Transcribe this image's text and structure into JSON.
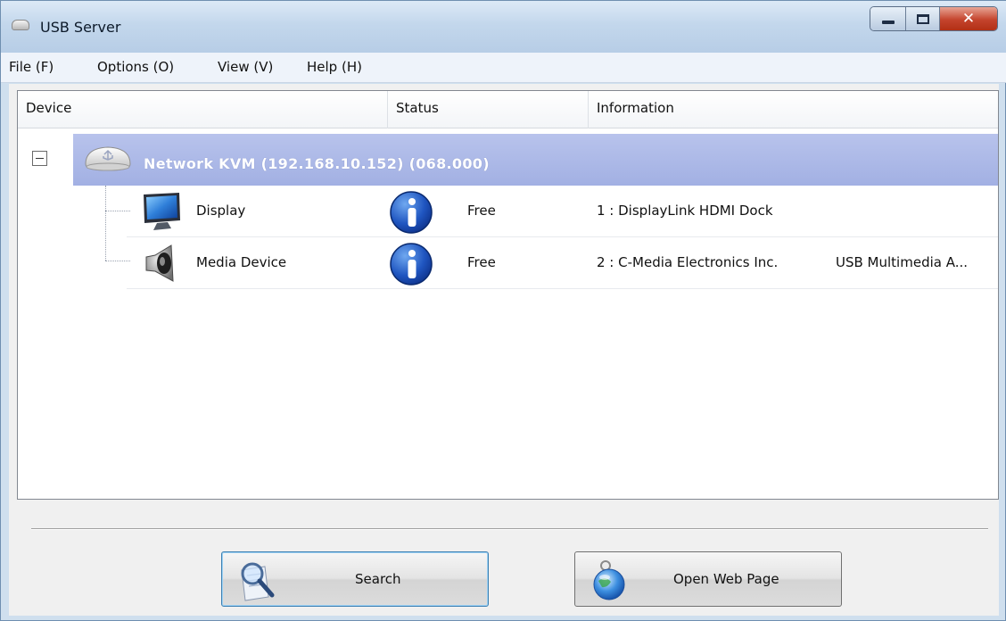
{
  "window": {
    "title": "USB Server"
  },
  "menu": {
    "items": [
      "File (F)",
      "Options (O)",
      "View (V)",
      "Help (H)"
    ]
  },
  "list": {
    "columns": [
      "Device",
      "Status",
      "Information"
    ],
    "group": {
      "label": "Network KVM  (192.168.10.152) (068.000)",
      "expanded": true
    },
    "devices": [
      {
        "name": "Display",
        "icon": "monitor-icon",
        "status": "Free",
        "status_icon": "info-icon",
        "info": "1 : DisplayLink HDMI Dock",
        "info_extra": ""
      },
      {
        "name": "Media Device",
        "icon": "speaker-icon",
        "status": "Free",
        "status_icon": "info-icon",
        "info": "2 : C-Media Electronics Inc.",
        "info_extra": "USB Multimedia A..."
      }
    ]
  },
  "buttons": {
    "search": "Search",
    "open_web": "Open Web Page"
  },
  "colors": {
    "group_row": "#a9b6e6",
    "accent_blue": "#2b5fb8",
    "title_bar": "#c3d7ec"
  }
}
